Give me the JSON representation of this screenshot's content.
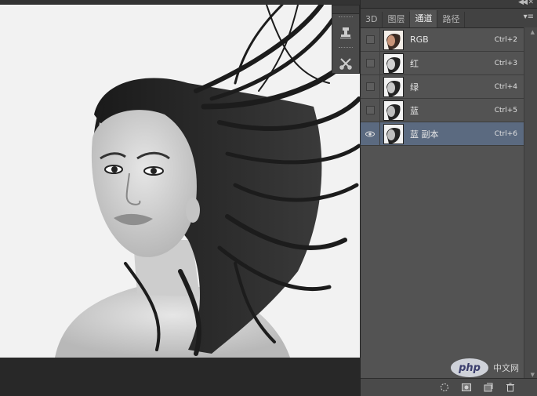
{
  "tabs": [
    {
      "label": "3D",
      "active": false
    },
    {
      "label": "图层",
      "active": false
    },
    {
      "label": "通道",
      "active": true
    },
    {
      "label": "路径",
      "active": false
    }
  ],
  "channels": [
    {
      "name": "RGB",
      "shortcut": "Ctrl+2",
      "visible": false,
      "selected": false,
      "thumb": "color"
    },
    {
      "name": "红",
      "shortcut": "Ctrl+3",
      "visible": false,
      "selected": false,
      "thumb": "gray"
    },
    {
      "name": "绿",
      "shortcut": "Ctrl+4",
      "visible": false,
      "selected": false,
      "thumb": "gray"
    },
    {
      "name": "蓝",
      "shortcut": "Ctrl+5",
      "visible": false,
      "selected": false,
      "thumb": "gray"
    },
    {
      "name": "蓝 副本",
      "shortcut": "Ctrl+6",
      "visible": true,
      "selected": true,
      "thumb": "gray"
    }
  ],
  "footer_icons": [
    "load-selection-icon",
    "save-selection-icon",
    "new-channel-icon",
    "delete-channel-icon"
  ],
  "watermark": {
    "logo": "php",
    "text": "中文网"
  },
  "colors": {
    "panel": "#535353",
    "selected": "#5b6a80",
    "canvas": "#f2f2f2"
  }
}
